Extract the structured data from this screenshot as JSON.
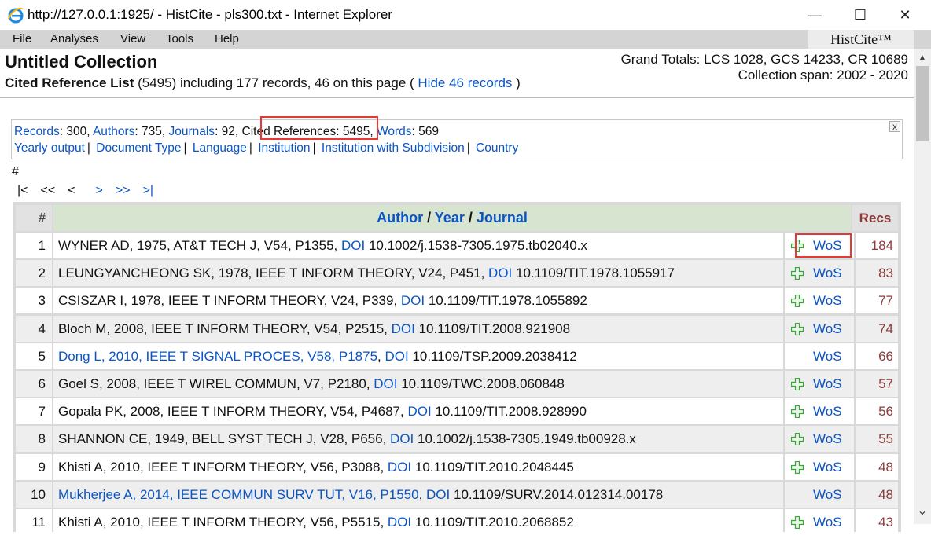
{
  "window": {
    "title": "http://127.0.0.1:1925/ - HistCite - pls300.txt - Internet Explorer",
    "minimize": "—",
    "maximize": "☐",
    "close": "✕"
  },
  "menu": {
    "items": [
      "File",
      "Analyses",
      "View",
      "Tools",
      "Help"
    ],
    "brand": "HistCite™"
  },
  "header": {
    "title": "Untitled Collection",
    "subtitle_bold": "Cited Reference List",
    "subtitle_rest": " (5495) including 177 records, 46 on this page ( ",
    "hide_link": "Hide 46 records",
    "subtitle_end": " )",
    "grand_totals": "Grand Totals: LCS 1028, GCS 14233, CR 10689",
    "collection_span": "Collection span: 2002 - 2020"
  },
  "info": {
    "records_label": "Records",
    "records_value": ": 300, ",
    "authors_label": "Authors",
    "authors_value": ": 735, ",
    "journals_label": "Journals",
    "journals_value": ": 92, ",
    "cited_label": "Cited References",
    "cited_value": ": 5495, ",
    "words_label": "Words",
    "words_value": ": 569",
    "links": [
      "Yearly output",
      "Document Type",
      "Language",
      "Institution",
      "Institution with Subdivision",
      "Country"
    ],
    "close": "x"
  },
  "hash": "#",
  "pager": {
    "first": "|<",
    "prev_many": "<<",
    "prev": "<",
    "next": ">",
    "next_many": ">>",
    "last": ">|"
  },
  "table": {
    "col_num": "#",
    "col_author": "Author",
    "col_sep": " / ",
    "col_year": "Year",
    "col_journal": "Journal",
    "col_recs": "Recs",
    "doi_label": "DOI",
    "wos_label": "WoS",
    "rows": [
      {
        "num": "1",
        "ref": "WYNER AD, 1975, AT&T TECH J, V54, P1355, ",
        "ref_is_link": false,
        "doi": " 10.1002/j.1538-7305.1975.tb02040.x",
        "plus": true,
        "recs": "184"
      },
      {
        "num": "2",
        "ref": "LEUNGYANCHEONG SK, 1978, IEEE T INFORM THEORY, V24, P451, ",
        "ref_is_link": false,
        "doi": " 10.1109/TIT.1978.1055917",
        "plus": true,
        "recs": "83"
      },
      {
        "num": "3",
        "ref": "CSISZAR I, 1978, IEEE T INFORM THEORY, V24, P339, ",
        "ref_is_link": false,
        "doi": " 10.1109/TIT.1978.1055892",
        "plus": true,
        "recs": "77"
      },
      {
        "num": "4",
        "ref": "Bloch M, 2008, IEEE T INFORM THEORY, V54, P2515, ",
        "ref_is_link": false,
        "doi": " 10.1109/TIT.2008.921908",
        "plus": true,
        "recs": "74"
      },
      {
        "num": "5",
        "ref": "Dong L, 2010, IEEE T SIGNAL PROCES, V58, P1875",
        "ref_is_link": true,
        "doi": " 10.1109/TSP.2009.2038412",
        "plus": false,
        "recs": "66"
      },
      {
        "num": "6",
        "ref": "Goel S, 2008, IEEE T WIREL COMMUN, V7, P2180, ",
        "ref_is_link": false,
        "doi": " 10.1109/TWC.2008.060848",
        "plus": true,
        "recs": "57"
      },
      {
        "num": "7",
        "ref": "Gopala PK, 2008, IEEE T INFORM THEORY, V54, P4687, ",
        "ref_is_link": false,
        "doi": " 10.1109/TIT.2008.928990",
        "plus": true,
        "recs": "56"
      },
      {
        "num": "8",
        "ref": "SHANNON CE, 1949, BELL SYST TECH J, V28, P656, ",
        "ref_is_link": false,
        "doi": " 10.1002/j.1538-7305.1949.tb00928.x",
        "plus": true,
        "recs": "55"
      },
      {
        "num": "9",
        "ref": "Khisti A, 2010, IEEE T INFORM THEORY, V56, P3088, ",
        "ref_is_link": false,
        "doi": " 10.1109/TIT.2010.2048445",
        "plus": true,
        "recs": "48"
      },
      {
        "num": "10",
        "ref": "Mukherjee A, 2014, IEEE COMMUN SURV TUT, V16, P1550",
        "ref_is_link": true,
        "doi": " 10.1109/SURV.2014.012314.00178",
        "plus": false,
        "recs": "48"
      },
      {
        "num": "11",
        "ref": "Khisti A, 2010, IEEE T INFORM THEORY, V56, P5515, ",
        "ref_is_link": false,
        "doi": " 10.1109/TIT.2010.2068852",
        "plus": true,
        "recs": "43"
      }
    ]
  },
  "colors": {
    "link": "#0a55c6",
    "recs": "#8b3a3a",
    "highlight": "#e53935",
    "author_header_bg": "#d7e4d0",
    "plus_icon": "#3aa63a"
  }
}
